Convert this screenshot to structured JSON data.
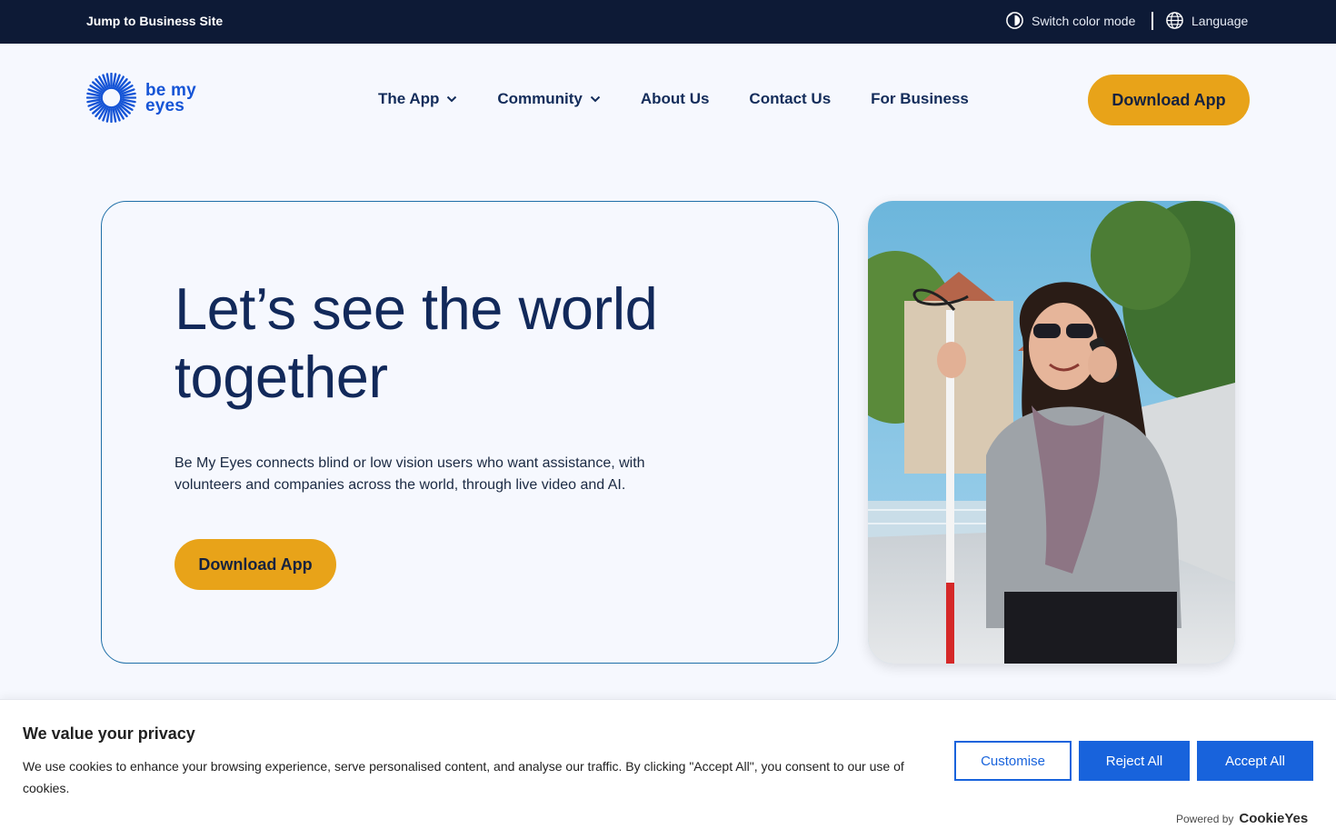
{
  "topbar": {
    "jump_link": "Jump to Business Site",
    "color_mode": "Switch color mode",
    "language": "Language"
  },
  "logo": {
    "line1": "be my",
    "line2": "eyes"
  },
  "nav": {
    "items": [
      {
        "label": "The App",
        "has_dropdown": true
      },
      {
        "label": "Community",
        "has_dropdown": true
      },
      {
        "label": "About Us",
        "has_dropdown": false
      },
      {
        "label": "Contact Us",
        "has_dropdown": false
      },
      {
        "label": "For Business",
        "has_dropdown": false
      }
    ],
    "download": "Download App"
  },
  "hero": {
    "title_line1": "Let’s see the world",
    "title_line2": "together",
    "description": "Be My Eyes connects blind or low vision users who want assistance, with volunteers and companies across the world, through live video and AI.",
    "download": "Download App"
  },
  "cookie": {
    "title": "We value your privacy",
    "text": "We use cookies to enhance your browsing experience, serve personalised content, and analyse our traffic. By clicking \"Accept All\", you consent to our use of cookies.",
    "customise": "Customise",
    "reject": "Reject All",
    "accept": "Accept All",
    "powered_by": "Powered by",
    "brand": "CookieYes"
  },
  "colors": {
    "topbar_bg": "#0d1a36",
    "brand_blue": "#1554d6",
    "accent_yellow": "#e8a319",
    "cookie_blue": "#1863dc"
  }
}
